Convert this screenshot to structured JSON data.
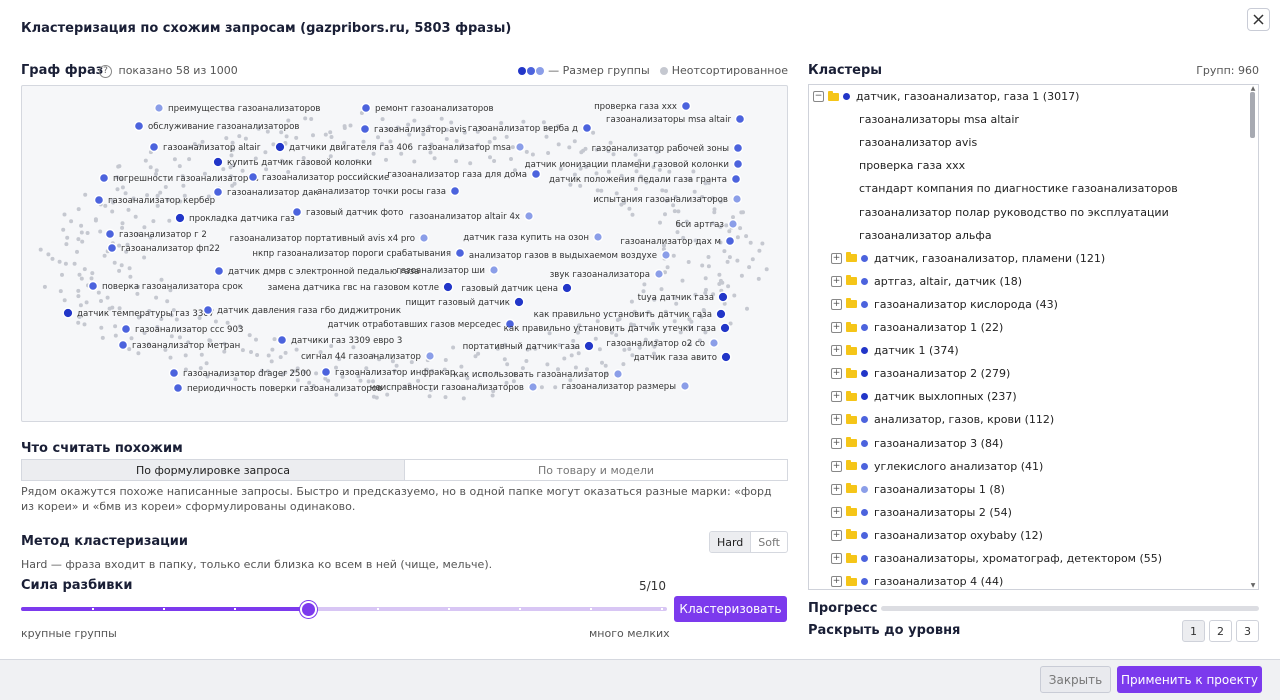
{
  "dialog": {
    "title": "Кластеризация по схожим запросам (gazpribors.ru, 5803 фразы)",
    "close_icon": "close-icon"
  },
  "graph": {
    "title": "Граф фраз",
    "help_icon": "?",
    "shown": "показано 58 из 1000",
    "legend_size": "— Размер группы",
    "legend_unsorted": "Неотсортированное",
    "colors": {
      "dark": "#2236c8",
      "mid": "#4c63dd",
      "light": "#8b9ee8",
      "gray": "#c5c8d0",
      "bg": "#f6f7f9"
    },
    "nodes": [
      {
        "label": "преимущества газоанализаторов",
        "tone": "light"
      },
      {
        "label": "ремонт газоанализаторов",
        "tone": "mid"
      },
      {
        "label": "проверка газа ххх",
        "tone": "mid"
      },
      {
        "label": "газоанализаторы msa altair",
        "tone": "mid"
      },
      {
        "label": "обслуживание газоанализаторов",
        "tone": "mid"
      },
      {
        "label": "газоанализатор avis",
        "tone": "mid"
      },
      {
        "label": "газоанализатор верба д",
        "tone": "mid"
      },
      {
        "label": "газоанализатор altair",
        "tone": "mid"
      },
      {
        "label": "датчики двигателя газ 406",
        "tone": "dark"
      },
      {
        "label": "газоанализатор msa",
        "tone": "light"
      },
      {
        "label": "газоанализатор рабочей зоны",
        "tone": "mid"
      },
      {
        "label": "купить датчик газовой колонки",
        "tone": "dark"
      },
      {
        "label": "датчик ионизации пламени газовой колонки",
        "tone": "mid"
      },
      {
        "label": "погрешности газоанализаторов",
        "tone": "mid"
      },
      {
        "label": "газоанализатор российские",
        "tone": "mid"
      },
      {
        "label": "газоанализатор газа для дома",
        "tone": "mid"
      },
      {
        "label": "датчик положения педали газа гранта",
        "tone": "mid"
      },
      {
        "label": "газоанализатор дак",
        "tone": "mid"
      },
      {
        "label": "анализатор точки росы газа",
        "tone": "mid"
      },
      {
        "label": "газоанализатор кербер",
        "tone": "mid"
      },
      {
        "label": "испытания газоанализаторов",
        "tone": "light"
      },
      {
        "label": "прокладка датчика газ",
        "tone": "dark"
      },
      {
        "label": "газовый датчик фото",
        "tone": "mid"
      },
      {
        "label": "газоанализатор altair 4x",
        "tone": "light"
      },
      {
        "label": "бси артгаз",
        "tone": "light"
      },
      {
        "label": "газоанализатор г 2",
        "tone": "mid"
      },
      {
        "label": "газоанализатор портативный avis x4 pro",
        "tone": "light"
      },
      {
        "label": "датчик газа купить на озон",
        "tone": "light"
      },
      {
        "label": "газоанализатор дах м",
        "tone": "mid"
      },
      {
        "label": "газоанализатор фп22",
        "tone": "mid"
      },
      {
        "label": "нкпр газоанализатор пороги срабатывания",
        "tone": "mid"
      },
      {
        "label": "анализатор газов в выдыхаемом воздухе",
        "tone": "light"
      },
      {
        "label": "датчик дмрв с электронной педалью газа",
        "tone": "mid"
      },
      {
        "label": "газоанализатор ши",
        "tone": "light"
      },
      {
        "label": "звук газоанализатора",
        "tone": "light"
      },
      {
        "label": "поверка газоанализатора срок",
        "tone": "mid"
      },
      {
        "label": "замена датчика гвс на газовом котле",
        "tone": "dark"
      },
      {
        "label": "газовый датчик цена",
        "tone": "dark"
      },
      {
        "label": "tuya датчик газа",
        "tone": "dark"
      },
      {
        "label": "пищит газовый датчик",
        "tone": "dark"
      },
      {
        "label": "датчик температуры газ 3307",
        "tone": "dark"
      },
      {
        "label": "датчик давления газа гбо диджитроник",
        "tone": "mid"
      },
      {
        "label": "как правильно установить датчик газа",
        "tone": "dark"
      },
      {
        "label": "газоанализатор ссс 903",
        "tone": "mid"
      },
      {
        "label": "датчик отработавших газов мерседес",
        "tone": "mid"
      },
      {
        "label": "как правильно установить датчик утечки газа",
        "tone": "dark"
      },
      {
        "label": "датчики газ 3309 евро 3",
        "tone": "mid"
      },
      {
        "label": "газоанализатор метран",
        "tone": "mid"
      },
      {
        "label": "портативный датчик газа",
        "tone": "dark"
      },
      {
        "label": "газоанализатор о2 со",
        "tone": "light"
      },
      {
        "label": "сигнал 44 газоанализатор",
        "tone": "light"
      },
      {
        "label": "датчик газа авито",
        "tone": "dark"
      },
      {
        "label": "газоанализатор drager 2500",
        "tone": "mid"
      },
      {
        "label": "газоанализатор инфракар",
        "tone": "mid"
      },
      {
        "label": "как использовать газоанализатор",
        "tone": "light"
      },
      {
        "label": "периодичность поверки газоанализаторов",
        "tone": "mid"
      },
      {
        "label": "неисправности газоанализаторов",
        "tone": "light"
      },
      {
        "label": "газоанализатор размеры",
        "tone": "light"
      }
    ]
  },
  "similarity": {
    "title": "Что считать похожим",
    "tab_formulation": "По формулировке запроса",
    "tab_product": "По товару и модели",
    "description": "Рядом окажутся похоже написанные запросы. Быстро и предсказуемо, но в одной папке могут оказаться разные марки: «форд из кореи» и «бмв из кореи» сформулированы одинаково."
  },
  "method": {
    "title": "Метод кластеризации",
    "hard": "Hard",
    "soft": "Soft",
    "description": "Hard — фраза входит в папку, только если близка ко всем в ней (чище, мельче)."
  },
  "strength": {
    "title": "Сила разбивки",
    "value_text": "5/10",
    "value": 5,
    "max": 10,
    "min_label": "крупные группы",
    "max_label": "много мелких",
    "cluster_button": "Кластеризовать"
  },
  "clusters": {
    "title": "Кластеры",
    "count": "Групп: 960",
    "root": {
      "label": "датчик, газоанализатор, газа 1 (3017)",
      "tone": "dark"
    },
    "root_children": [
      "газоанализаторы msa altair",
      "газоанализатор avis",
      "проверка газа ххх",
      "стандарт компания по диагностике газоанализаторов",
      "газоанализатор полар руководство по эксплуатации",
      "газоанализатор альфа"
    ],
    "groups": [
      {
        "label": "датчик, газоанализатор, пламени (121)",
        "tone": "mid"
      },
      {
        "label": "артгаз, altair, датчик (18)",
        "tone": "mid"
      },
      {
        "label": "газоанализатор кислорода (43)",
        "tone": "mid"
      },
      {
        "label": "газоанализатор 1 (22)",
        "tone": "mid"
      },
      {
        "label": "датчик 1 (374)",
        "tone": "dark"
      },
      {
        "label": "газоанализатор 2 (279)",
        "tone": "dark"
      },
      {
        "label": "датчик выхлопных (237)",
        "tone": "dark"
      },
      {
        "label": "анализатор, газов, крови (112)",
        "tone": "mid"
      },
      {
        "label": "газоанализатор 3 (84)",
        "tone": "mid"
      },
      {
        "label": "углекислого анализатор (41)",
        "tone": "mid"
      },
      {
        "label": "газоанализаторы 1 (8)",
        "tone": "light"
      },
      {
        "label": "газоанализаторы 2 (54)",
        "tone": "mid"
      },
      {
        "label": "газоанализатор oxybaby (12)",
        "tone": "mid"
      },
      {
        "label": "газоанализаторы, хроматограф, детектором (55)",
        "tone": "mid"
      },
      {
        "label": "газоанализатор 4 (44)",
        "tone": "mid"
      }
    ]
  },
  "progress": {
    "label": "Прогресс",
    "value": 0
  },
  "expand": {
    "label": "Раскрыть до уровня",
    "levels": [
      "1",
      "2",
      "3"
    ],
    "selected": "1"
  },
  "footer": {
    "close": "Закрыть",
    "apply": "Применить к проекту"
  }
}
